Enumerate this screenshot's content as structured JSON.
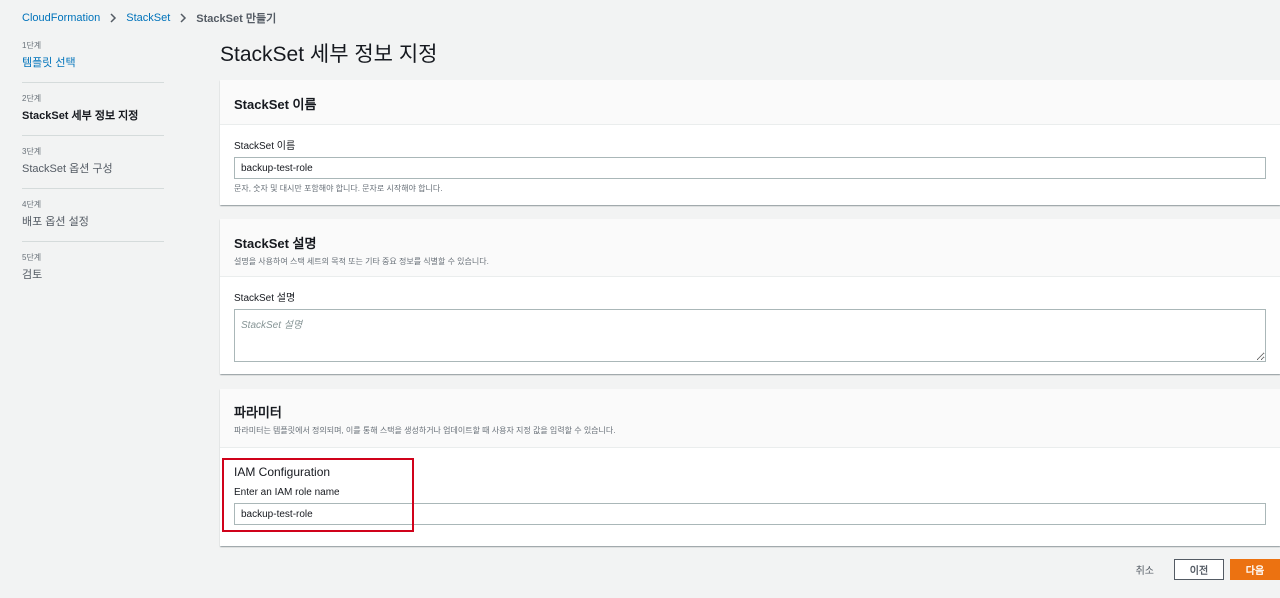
{
  "breadcrumb": {
    "items": [
      "CloudFormation",
      "StackSet"
    ],
    "current": "StackSet 만들기"
  },
  "steps": [
    {
      "num": "1단계",
      "title": "템플릿 선택"
    },
    {
      "num": "2단계",
      "title": "StackSet 세부 정보 지정"
    },
    {
      "num": "3단계",
      "title": "StackSet 옵션 구성"
    },
    {
      "num": "4단계",
      "title": "배포 옵션 설정"
    },
    {
      "num": "5단계",
      "title": "검토"
    }
  ],
  "page_title": "StackSet 세부 정보 지정",
  "name_panel": {
    "header": "StackSet 이름",
    "label": "StackSet 이름",
    "value": "backup-test-role",
    "hint": "문자, 숫자 및 대시만 포함해야 합니다. 문자로 시작해야 합니다."
  },
  "desc_panel": {
    "header": "StackSet 설명",
    "description": "설명을 사용하여 스택 세트의 목적 또는 기타 중요 정보를 식별할 수 있습니다.",
    "label": "StackSet 설명",
    "placeholder": "StackSet 설명"
  },
  "params_panel": {
    "header": "파라미터",
    "description": "파라미터는 템플릿에서 정의되며, 이를 통해 스택을 생성하거나 업데이트할 때 사용자 지정 값을 입력할 수 있습니다.",
    "group_title": "IAM Configuration",
    "label": "Enter an IAM role name",
    "value": "backup-test-role"
  },
  "footer": {
    "cancel": "취소",
    "previous": "이전",
    "next": "다음"
  },
  "colors": {
    "link": "#0073bb",
    "primary": "#ec7211",
    "highlight": "#d0021b"
  }
}
